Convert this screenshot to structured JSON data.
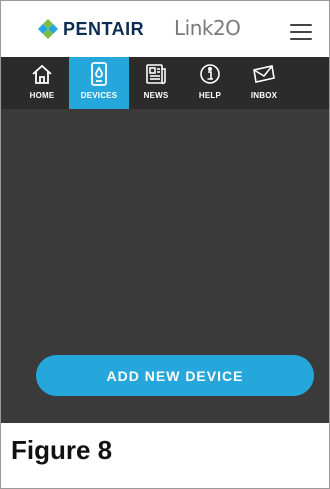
{
  "header": {
    "brand": "PENTAIR",
    "app_logo": "Link2O",
    "menu_icon": "hamburger-menu-icon"
  },
  "nav": {
    "items": [
      {
        "label": "HOME",
        "icon": "home-icon",
        "active": false
      },
      {
        "label": "DEVICES",
        "icon": "device-icon",
        "active": true
      },
      {
        "label": "NEWS",
        "icon": "news-icon",
        "active": false
      },
      {
        "label": "HELP",
        "icon": "help-icon",
        "active": false
      },
      {
        "label": "INBOX",
        "icon": "inbox-icon",
        "active": false
      }
    ]
  },
  "main": {
    "add_button_label": "ADD NEW DEVICE"
  },
  "caption": {
    "text": "Figure 8"
  },
  "colors": {
    "accent": "#26a7dc",
    "navbar_bg": "#2b2b2b",
    "content_bg": "#3a3a3a",
    "brand_text": "#0d2c54",
    "logo_green": "#7dbb42",
    "logo_blue": "#26a7dc"
  }
}
